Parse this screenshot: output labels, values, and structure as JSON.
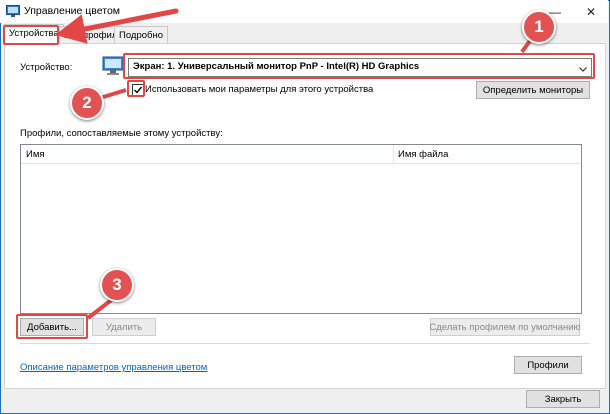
{
  "window": {
    "title": "Управление цветом",
    "close_symbol": "✕",
    "minimize_symbol": "—"
  },
  "tabs": [
    {
      "label": "Устройства",
      "active": true
    },
    {
      "label": "Все профили",
      "active": false
    },
    {
      "label": "Подробно",
      "active": false
    }
  ],
  "device": {
    "label": "Устройство:",
    "selected": "Экран: 1. Универсальный монитор PnP - Intel(R) HD Graphics",
    "use_settings_label": "Использовать мои параметры для этого устройства",
    "use_settings_checked": true,
    "identify_button": "Определить мониторы"
  },
  "profiles": {
    "label": "Профили, сопоставляемые этому устройству:",
    "columns": [
      "Имя",
      "Имя файла"
    ],
    "rows": []
  },
  "actions": {
    "add": "Добавить...",
    "remove": "Удалить",
    "set_default": "Сделать профилем по умолчанию"
  },
  "footer": {
    "link": "Описание параметров управления цветом",
    "profiles_button": "Профили",
    "close_button": "Закрыть"
  },
  "annotations": [
    "1",
    "2",
    "3"
  ],
  "colors": {
    "highlight": "#e14747",
    "accent": "#0066cc"
  }
}
